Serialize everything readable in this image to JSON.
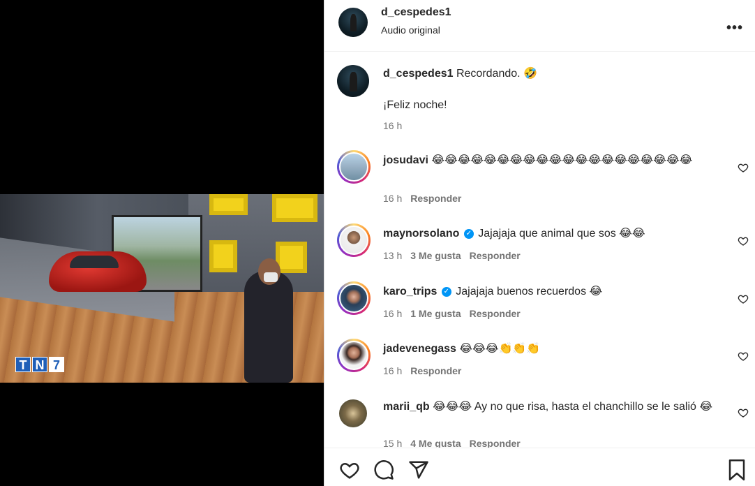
{
  "video": {
    "logo_letters": [
      "T",
      "N",
      "7"
    ]
  },
  "header": {
    "username": "d_cespedes1",
    "subtitle": "Audio original",
    "more_icon": "more-horizontal-icon"
  },
  "caption": {
    "username": "d_cespedes1",
    "text": "Recordando. 🤣",
    "text2": "¡Feliz noche!",
    "time": "16 h"
  },
  "comments": [
    {
      "username": "josudavi",
      "verified": false,
      "text": "😂😂😂😂😂😂😂😂😂😂😂😂😂😂😂😂😂😂😂😂",
      "time": "16 h",
      "likes": "",
      "reply": "Responder"
    },
    {
      "username": "maynorsolano",
      "verified": true,
      "text": "Jajajaja que animal que sos 😂😂",
      "time": "13 h",
      "likes": "3 Me gusta",
      "reply": "Responder"
    },
    {
      "username": "karo_trips",
      "verified": true,
      "text": "Jajajaja buenos recuerdos 😂",
      "time": "16 h",
      "likes": "1 Me gusta",
      "reply": "Responder"
    },
    {
      "username": "jadevenegass",
      "verified": false,
      "text": "😂😂😂👏👏👏",
      "time": "16 h",
      "likes": "",
      "reply": "Responder"
    },
    {
      "username": "marii_qb",
      "verified": false,
      "text": "😂😂😂 Ay no que risa, hasta el chanchillo se le salió 😂",
      "time": "15 h",
      "likes": "4 Me gusta",
      "reply": "Responder"
    }
  ],
  "actions": {
    "like_icon": "heart-icon",
    "comment_icon": "comment-icon",
    "share_icon": "send-icon",
    "save_icon": "bookmark-icon"
  }
}
